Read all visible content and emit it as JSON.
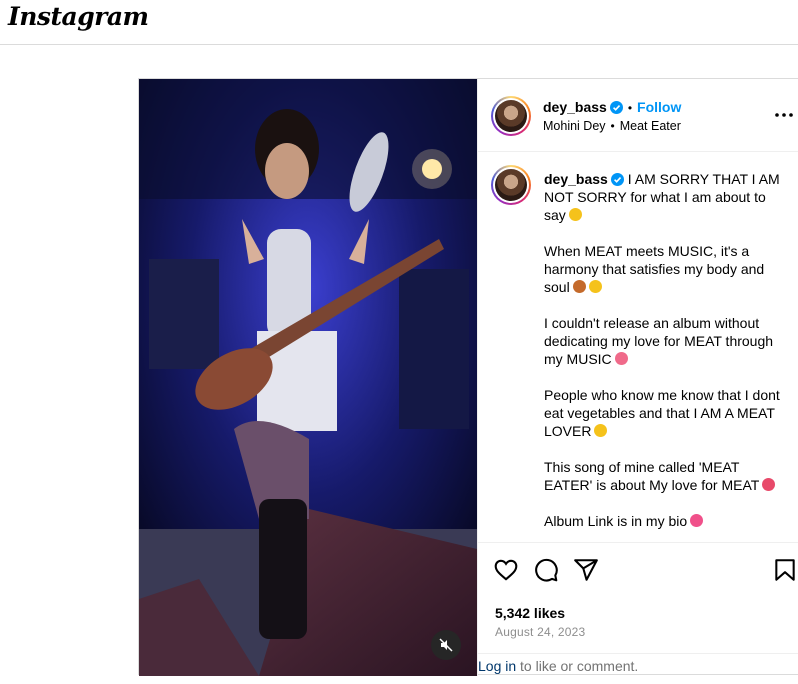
{
  "app": {
    "logo": "Instagram"
  },
  "post": {
    "username": "dey_bass",
    "follow_label": "Follow",
    "dot": "•",
    "subtitle_name": "Mohini Dey",
    "subtitle_audio": "Meat Eater",
    "caption_paragraphs": [
      {
        "text": "I AM SORRY THAT I AM NOT SORRY for what I am about to say",
        "emoji_color": "#f5c21b"
      },
      {
        "text": "When MEAT meets MUSIC, it's a harmony that satisfies my body and soul",
        "emoji_color": "#c46a2b",
        "emoji2_color": "#f5c21b"
      },
      {
        "text": "I couldn't release an album without dedicating my love for MEAT through my MUSIC",
        "emoji_color": "#f06a8a"
      },
      {
        "text": "People who know me know that I dont eat vegetables and that I AM A MEAT LOVER",
        "emoji_color": "#f5c21b"
      },
      {
        "text": "This song of mine called 'MEAT EATER' is about My love for MEAT",
        "emoji_color": "#e84a6a"
      },
      {
        "text": "Album Link is in my bio",
        "emoji_color": "#f0508a"
      }
    ],
    "likes": "5,342 likes",
    "date": "August 24, 2023",
    "login_link": "Log in",
    "login_rest": " to like or comment."
  },
  "icons": {
    "verified": "verified-badge-icon",
    "more": "more-options-icon",
    "like": "heart-icon",
    "comment": "comment-icon",
    "share": "share-icon",
    "save": "bookmark-icon",
    "mute": "muted-speaker-icon"
  },
  "colors": {
    "accent": "#0095f6",
    "link": "#00376b",
    "muted": "#8e8e8e",
    "border": "#dbdbdb"
  }
}
